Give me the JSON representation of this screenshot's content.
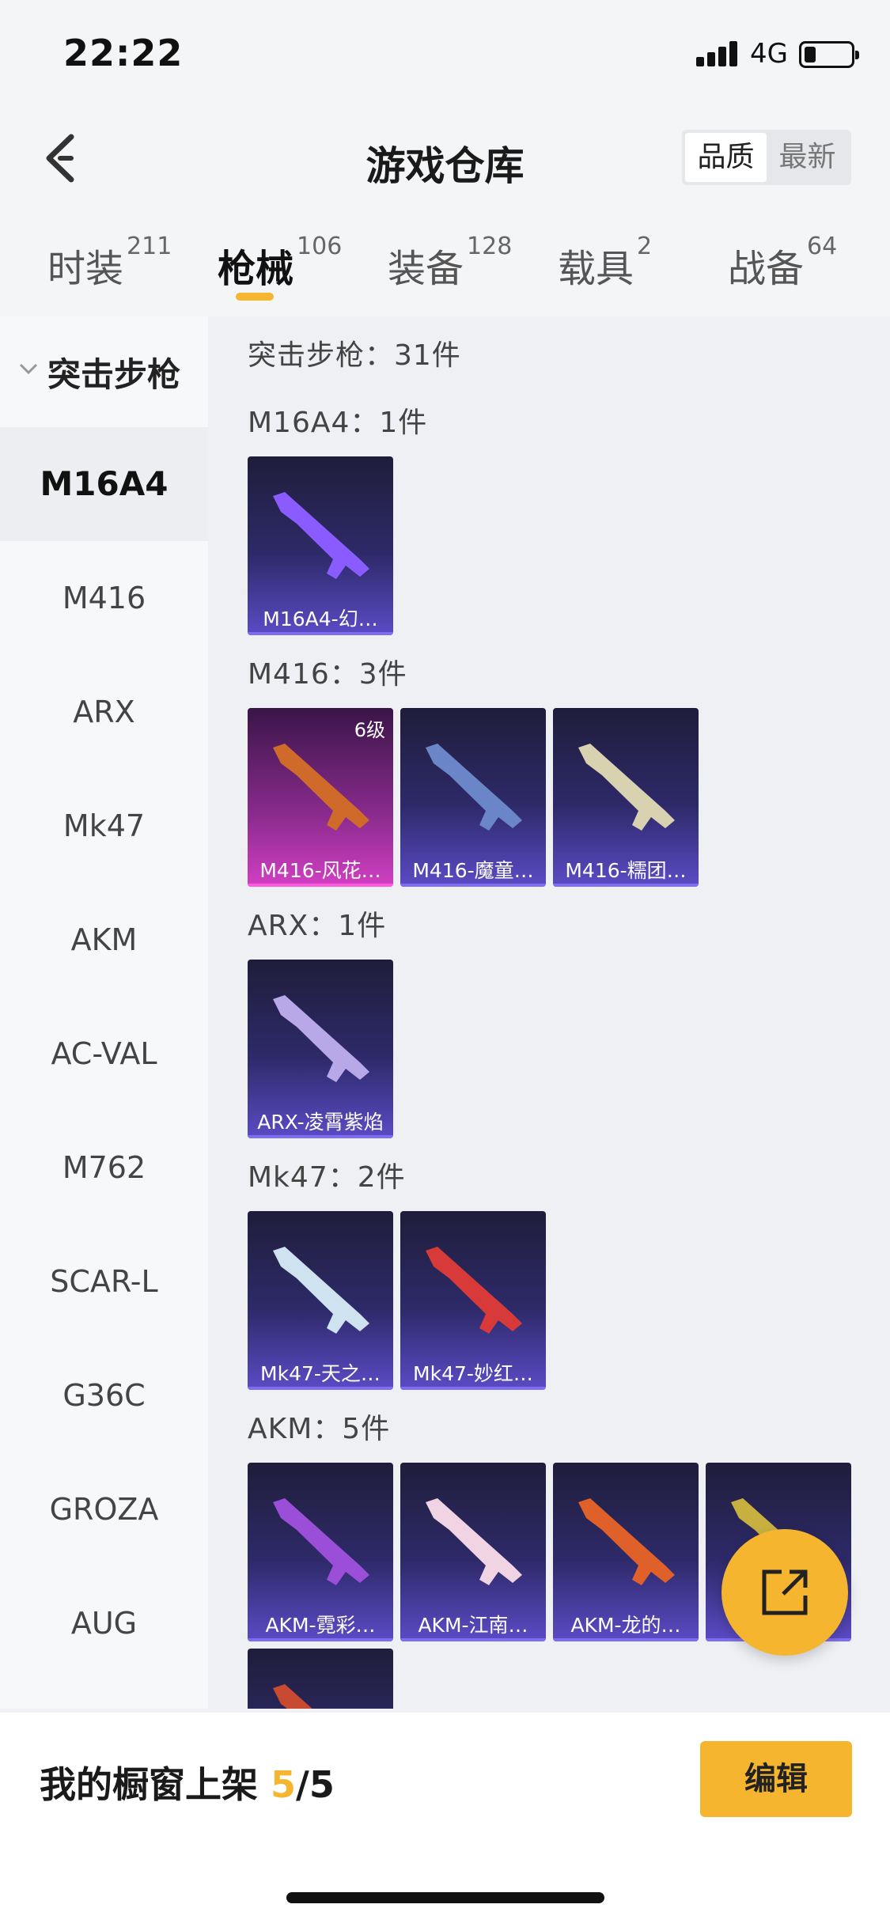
{
  "status": {
    "time": "22:22",
    "network": "4G"
  },
  "header": {
    "title": "游戏仓库",
    "sort_options": [
      "品质",
      "最新"
    ],
    "active_sort": "品质"
  },
  "tabs": [
    {
      "label": "时装",
      "count": "211"
    },
    {
      "label": "枪械",
      "count": "106"
    },
    {
      "label": "装备",
      "count": "128"
    },
    {
      "label": "载具",
      "count": "2"
    },
    {
      "label": "战备",
      "count": "64"
    }
  ],
  "active_tab": "枪械",
  "sidebar": {
    "category": "突击步枪",
    "items": [
      "M16A4",
      "M416",
      "ARX",
      "Mk47",
      "AKM",
      "AC-VAL",
      "M762",
      "SCAR-L",
      "G36C",
      "GROZA",
      "AUG"
    ],
    "active_item": "M16A4"
  },
  "content": {
    "summary": "突击步枪：31件",
    "sections": [
      {
        "title": "M16A4：1件",
        "items": [
          {
            "label": "M16A4-幻…",
            "color": "#8a5cff"
          }
        ]
      },
      {
        "title": "M416：3件",
        "items": [
          {
            "label": "M416-风花…",
            "level": "6级",
            "color": "#d06a2a"
          },
          {
            "label": "M416-魔童…",
            "color": "#6b86c8"
          },
          {
            "label": "M416-糯团…",
            "color": "#d8d2b0"
          }
        ]
      },
      {
        "title": "ARX：1件",
        "items": [
          {
            "label": "ARX-凌霄紫焰",
            "color": "#b8a8e8"
          }
        ]
      },
      {
        "title": "Mk47：2件",
        "items": [
          {
            "label": "Mk47-天之…",
            "color": "#cfe2f0"
          },
          {
            "label": "Mk47-妙红…",
            "color": "#d83a3a"
          }
        ]
      },
      {
        "title": "AKM：5件",
        "items": [
          {
            "label": "AKM-霓彩…",
            "color": "#9b4ed8"
          },
          {
            "label": "AKM-江南…",
            "color": "#f0d4e4"
          },
          {
            "label": "AKM-龙的…",
            "color": "#e0602a"
          },
          {
            "label": "",
            "color": "#c8b040"
          },
          {
            "label": "",
            "color": "#c84a30"
          }
        ]
      }
    ]
  },
  "footer": {
    "shelf_prefix": "我的橱窗上架 ",
    "shelf_used": "5",
    "shelf_total": "/5",
    "edit_label": "编辑"
  }
}
